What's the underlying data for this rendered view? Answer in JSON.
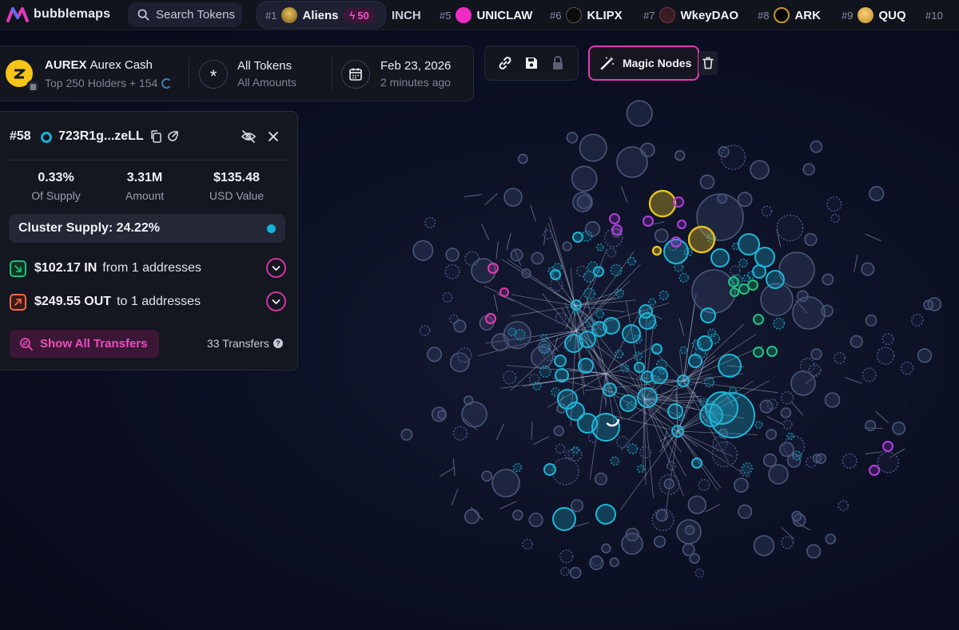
{
  "brand": {
    "name": "bubblemaps"
  },
  "search": {
    "label": "Search Tokens"
  },
  "trending": [
    {
      "rank": "#1",
      "name": "Aliens",
      "badge": "50",
      "icon_color": "#d7b24a"
    },
    {
      "rank": "",
      "name": "INCH",
      "icon_color": ""
    },
    {
      "rank": "#5",
      "name": "UNICLAW",
      "icon_color": "#f02bc4"
    },
    {
      "rank": "#6",
      "name": "KLIPX",
      "icon_color": "#111111"
    },
    {
      "rank": "#7",
      "name": "WkeyDAO",
      "icon_color": "#3a1c22"
    },
    {
      "rank": "#8",
      "name": "ARK",
      "icon_color": "#c69a2a"
    },
    {
      "rank": "#9",
      "name": "QUQ",
      "icon_color": "#e9b649"
    },
    {
      "rank": "#10",
      "name": "",
      "icon_color": ""
    }
  ],
  "token": {
    "symbol": "AUREX",
    "name": "Aurex Cash",
    "subtitle": "Top 250 Holders + 154",
    "filter_title": "All Tokens",
    "filter_sub": "All Amounts",
    "date": "Feb 23, 2026",
    "updated": "2 minutes ago"
  },
  "toolbar": {
    "link_icon": "link-icon",
    "save_icon": "save-icon",
    "lock_icon": "lock-icon",
    "magic_label": "Magic Nodes",
    "trash_icon": "trash-icon"
  },
  "wallet": {
    "rank": "#58",
    "address": "723R1g...zeLL",
    "stats": [
      {
        "value": "0.33%",
        "label": "Of Supply"
      },
      {
        "value": "3.31M",
        "label": "Amount"
      },
      {
        "value": "$135.48",
        "label": "USD Value"
      }
    ],
    "cluster": "Cluster Supply: 24.22%",
    "flow_in": {
      "value": "$102.17 IN",
      "rest": "from 1 addresses"
    },
    "flow_out": {
      "value": "$249.55 OUT",
      "rest": "to 1 addresses"
    },
    "show_all": "Show All Transfers",
    "transfers": "33 Transfers"
  },
  "colors": {
    "accent": "#e23bb5",
    "cyan_node": "#1fb6d6",
    "gold_node": "#e8c21f",
    "purple_node": "#b43fe0",
    "green_node": "#23c27e"
  }
}
